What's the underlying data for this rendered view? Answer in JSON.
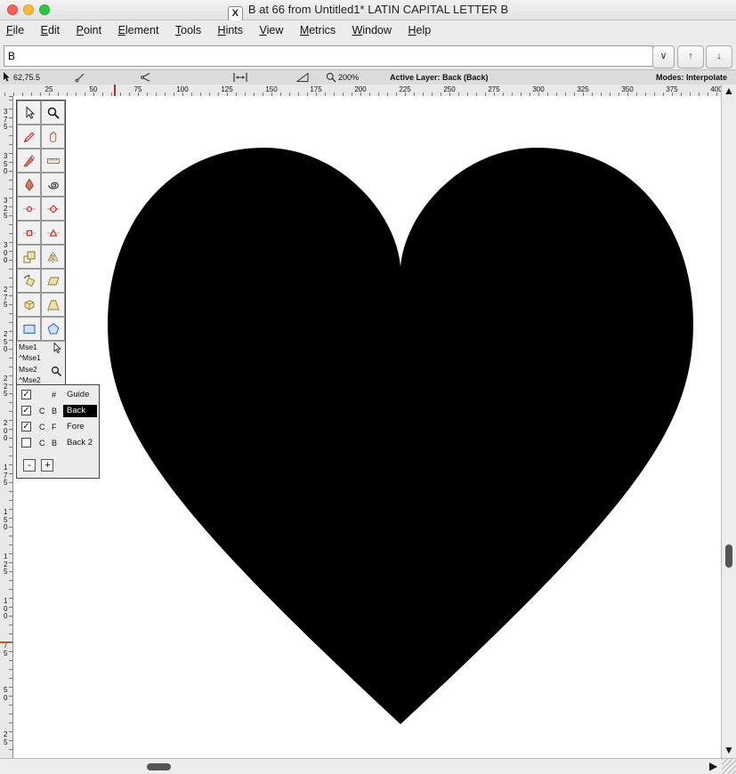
{
  "window": {
    "title": "B at 66 from Untitled1* LATIN CAPITAL LETTER B",
    "x11_badge": "X"
  },
  "menu": {
    "items": [
      "File",
      "Edit",
      "Point",
      "Element",
      "Tools",
      "Hints",
      "View",
      "Metrics",
      "Window",
      "Help"
    ]
  },
  "glyph_entry": {
    "value": "B",
    "dropdown_glyph": "∨",
    "up_glyph": "↑",
    "down_glyph": "↓"
  },
  "infobar": {
    "coords": "62,75.5",
    "zoom": "200%",
    "active_layer_label": "Active Layer: Back (Back)",
    "modes_label": "Modes: Interpolate"
  },
  "rulers": {
    "h": [
      "25",
      "50",
      "75",
      "100",
      "125",
      "150",
      "175",
      "200",
      "225",
      "250",
      "275",
      "300",
      "325",
      "350",
      "375",
      "400"
    ],
    "v": [
      "375",
      "350",
      "325",
      "300",
      "275",
      "250",
      "225",
      "200",
      "175",
      "150",
      "125",
      "100",
      "75",
      "50",
      "25"
    ]
  },
  "tool_palette": {
    "tools": [
      "pointer",
      "magnify",
      "freehand",
      "scroll-hand",
      "knife",
      "ruler",
      "pen",
      "spiro",
      "add-curve-point",
      "add-hvcurve-point",
      "add-corner-point",
      "add-tangent-point",
      "scale",
      "flip",
      "rotate",
      "skew",
      "rotate-3d",
      "perspective",
      "rectangle-ellipse",
      "polygon-star"
    ],
    "mouse_bindings": [
      "Mse1",
      "^Mse1",
      "Mse2",
      "^Mse2"
    ]
  },
  "layers": {
    "rows": [
      {
        "checked": "✓",
        "c1": "",
        "c2": "#",
        "name": "Guide"
      },
      {
        "checked": "✓",
        "c1": "C",
        "c2": "B",
        "name": "Back"
      },
      {
        "checked": "✓",
        "c1": "C",
        "c2": "F",
        "name": "Fore"
      },
      {
        "checked": "",
        "c1": "C",
        "c2": "B",
        "name": "Back 2"
      }
    ],
    "selected_layer": "Back",
    "remove_label": "-",
    "add_label": "+"
  },
  "canvas": {
    "glyph_fill": "#000000"
  },
  "scroll": {
    "up_glyph": "▲",
    "down_glyph": "▼",
    "right_glyph": "▶"
  },
  "colors": {
    "traffic_close": "#ff5f57",
    "traffic_minimize": "#febc2e",
    "traffic_maximize": "#28c840",
    "selected_layer_bg": "#000000",
    "h_cursor_tick": "#cc2222",
    "v_cursor_tick": "#c2591d"
  }
}
